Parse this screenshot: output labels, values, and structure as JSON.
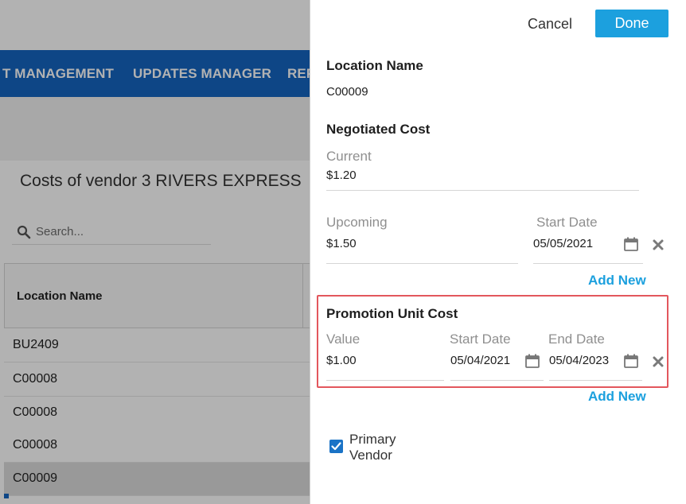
{
  "nav": {
    "item_1": "T MANAGEMENT",
    "item_2": "UPDATES MANAGER",
    "item_3": "REP"
  },
  "page": {
    "title": "Costs of vendor 3 RIVERS EXPRESS",
    "search_placeholder": "Search...",
    "table": {
      "column_location": "Location Name",
      "rows": [
        "BU2409",
        "C00008",
        "C00008",
        "C00008",
        "C00009"
      ],
      "selected_index": 4
    }
  },
  "panel": {
    "cancel_label": "Cancel",
    "done_label": "Done",
    "location": {
      "title": "Location Name",
      "value": "C00009"
    },
    "negotiated": {
      "title": "Negotiated Cost",
      "current_label": "Current",
      "current_value": "$1.20",
      "upcoming_label": "Upcoming",
      "upcoming_value": "$1.50",
      "start_date_label": "Start Date",
      "start_date_value": "05/05/2021",
      "add_new": "Add New"
    },
    "promotion": {
      "title": "Promotion Unit Cost",
      "value_label": "Value",
      "value": "$1.00",
      "start_date_label": "Start Date",
      "start_date_value": "05/04/2021",
      "end_date_label": "End Date",
      "end_date_value": "05/04/2023",
      "add_new": "Add New"
    },
    "primary_vendor": {
      "label": "Primary Vendor",
      "checked": true
    }
  },
  "colors": {
    "nav_bg": "#1565c0",
    "accent": "#1ca0de",
    "highlight_border": "#e3575d",
    "checkbox": "#1a73c6"
  }
}
